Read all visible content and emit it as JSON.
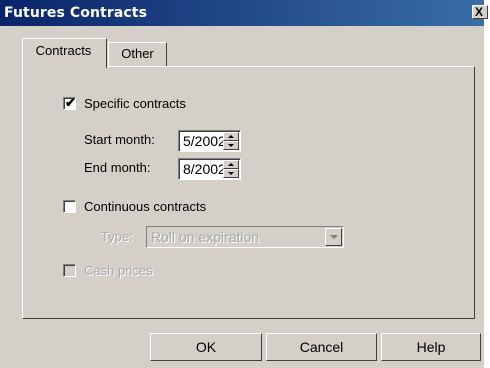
{
  "window": {
    "title": "Futures Contracts",
    "close_label": "X"
  },
  "tabs": [
    {
      "label": "Contracts",
      "active": true
    },
    {
      "label": "Other",
      "active": false
    }
  ],
  "specific": {
    "label": "Specific contracts",
    "checked": true,
    "mark": "✔"
  },
  "start": {
    "label": "Start month:",
    "value": "5/2002"
  },
  "end": {
    "label": "End month:",
    "value": "8/2002"
  },
  "continuous": {
    "label": "Continuous contracts",
    "checked": false
  },
  "type": {
    "label": "Type:",
    "value": "Roll on expiration",
    "enabled": false
  },
  "cash": {
    "label": "Cash prices",
    "checked": false,
    "enabled": false
  },
  "buttons": {
    "ok": "OK",
    "cancel": "Cancel",
    "help": "Help"
  }
}
